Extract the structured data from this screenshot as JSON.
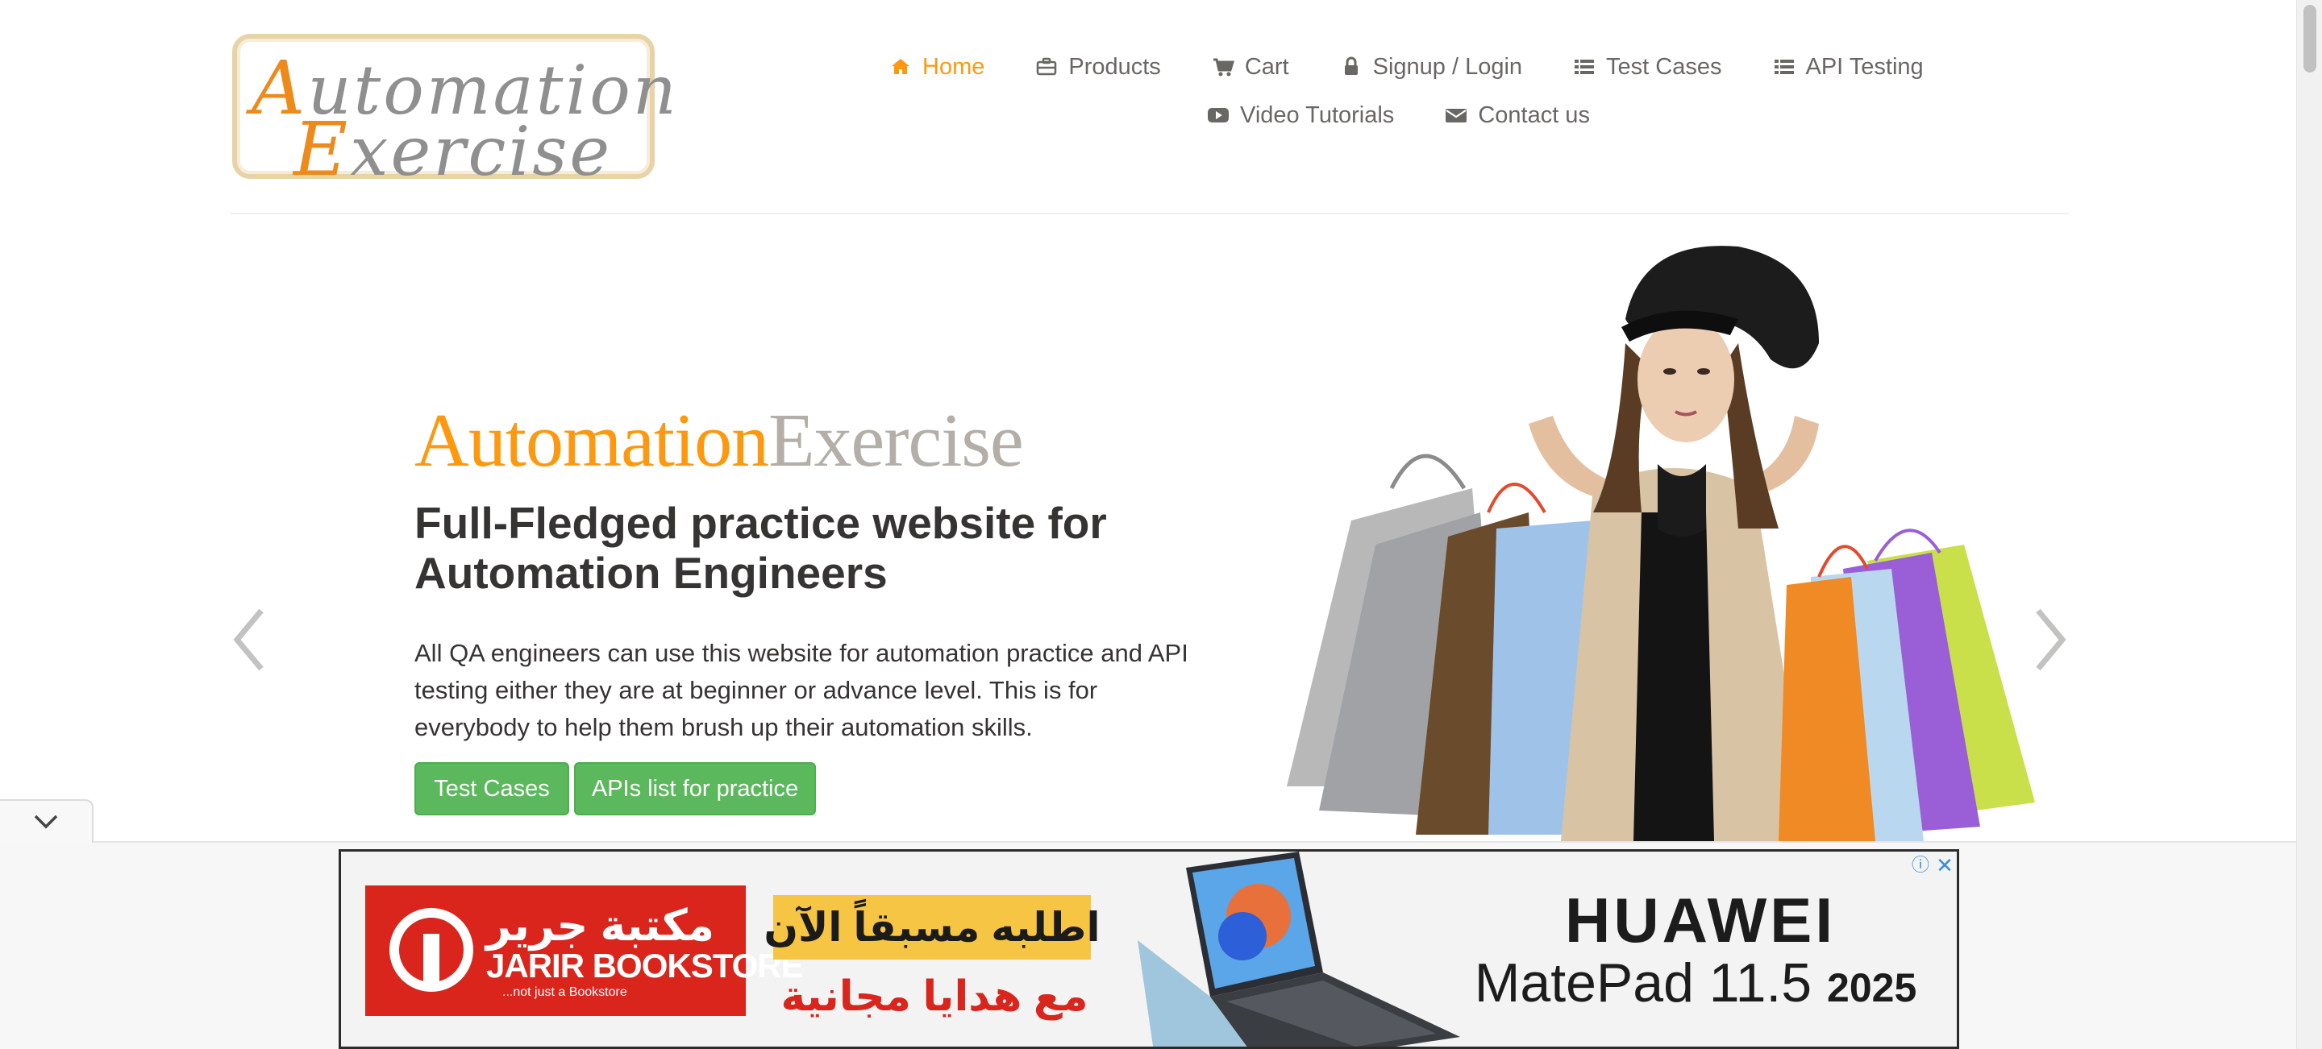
{
  "logo": {
    "line1": "Automation",
    "line2": "Exercise"
  },
  "nav": {
    "items": [
      {
        "label": "Home",
        "icon": "home-icon",
        "active": true
      },
      {
        "label": "Products",
        "icon": "briefcase-icon"
      },
      {
        "label": "Cart",
        "icon": "cart-icon"
      },
      {
        "label": "Signup / Login",
        "icon": "lock-icon"
      },
      {
        "label": "Test Cases",
        "icon": "list-icon"
      },
      {
        "label": "API Testing",
        "icon": "list-icon"
      },
      {
        "label": "Video Tutorials",
        "icon": "youtube-icon"
      },
      {
        "label": "Contact us",
        "icon": "envelope-icon"
      }
    ]
  },
  "hero": {
    "brand_part1": "Automation",
    "brand_part2": "Exercise",
    "title": "Full-Fledged practice website for Automation Engineers",
    "description": "All QA engineers can use this website for automation practice and API testing either they are at beginner or advance level. This is for everybody to help them brush up their automation skills.",
    "test_cases_button": "Test Cases",
    "apis_button": "APIs list for practice"
  },
  "ad": {
    "store_name_ar": "مكتبة جرير",
    "store_name_en": "JARIR BOOKSTORE",
    "store_tagline": "...not just a Bookstore",
    "cta_line1": "اطلبه مسبقاً الآن",
    "cta_line2": "مع هدايا مجانية",
    "brand": "HUAWEI",
    "model": "MatePad 11.5",
    "year": "2025",
    "info_symbol": "ⓘ",
    "close_symbol": "✕"
  },
  "colors": {
    "accent": "#fe980f",
    "text": "#696763",
    "heading": "#363432",
    "button": "#5cb85c"
  }
}
